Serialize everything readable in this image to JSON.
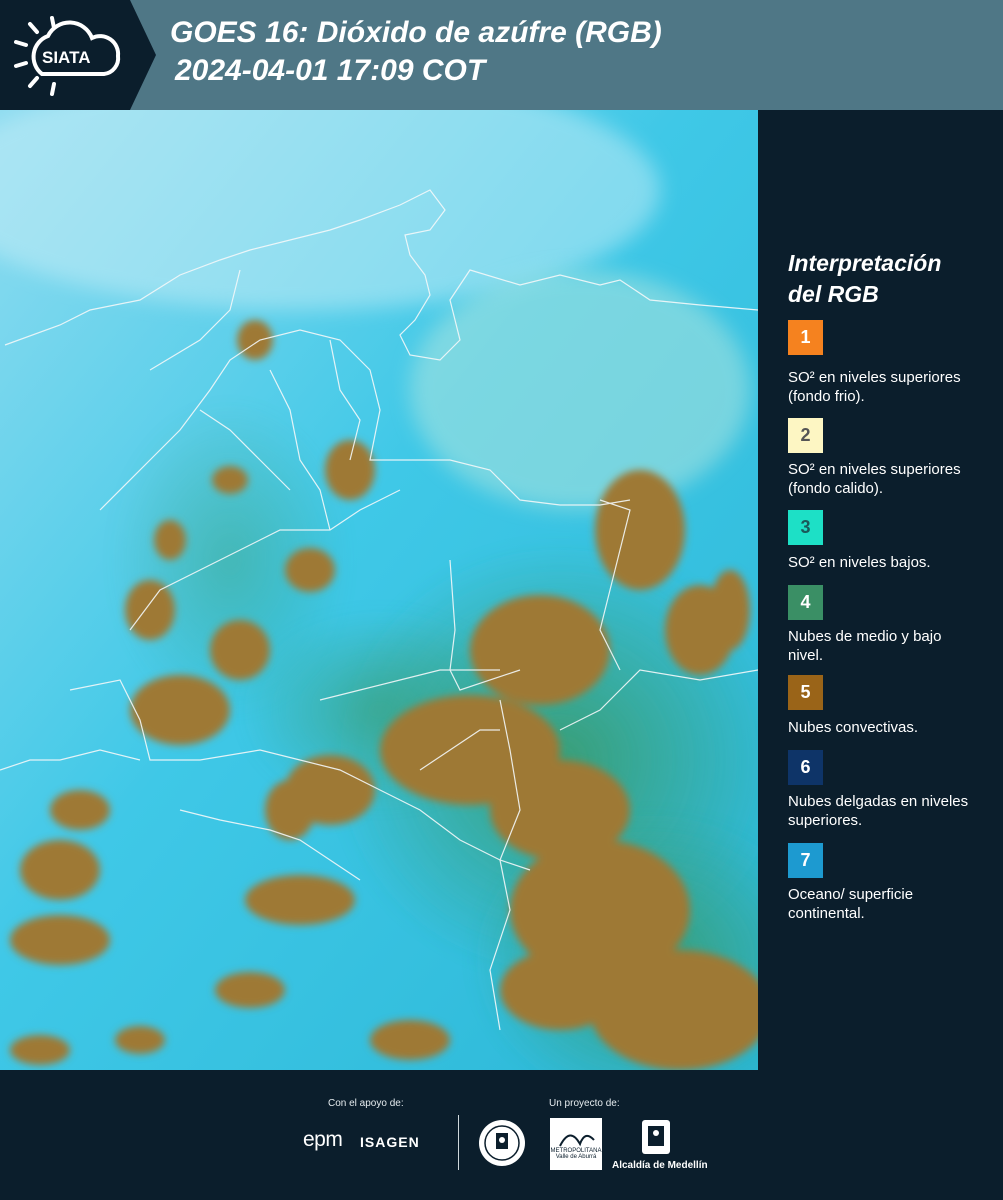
{
  "header": {
    "logo_text": "SIATA",
    "title_line1": "GOES 16: Dióxido de azúfre (RGB)",
    "title_line2": "2024-04-01 17:09 COT"
  },
  "legend": {
    "title_line1": "Interpretación",
    "title_line2": "del RGB",
    "items": [
      {
        "number": "1",
        "label": "SO² en niveles superiores (fondo frio).",
        "color": "#f5821f",
        "text_color": "#ffffff"
      },
      {
        "number": "2",
        "label": "SO² en niveles superiores (fondo calido).",
        "color": "#fdf6c3",
        "text_color": "#555555"
      },
      {
        "number": "3",
        "label": "SO² en niveles bajos.",
        "color": "#1de0c6",
        "text_color": "#1a5a5a"
      },
      {
        "number": "4",
        "label": "Nubes de medio y bajo nivel.",
        "color": "#3a8f65",
        "text_color": "#ffffff"
      },
      {
        "number": "5",
        "label": "Nubes convectivas.",
        "color": "#9a6418",
        "text_color": "#ffffff"
      },
      {
        "number": "6",
        "label": "Nubes delgadas en niveles superiores.",
        "color": "#0e3468",
        "text_color": "#ffffff"
      },
      {
        "number": "7",
        "label": "Oceano/ superficie continental.",
        "color": "#1d9ad0",
        "text_color": "#ffffff"
      }
    ]
  },
  "footer": {
    "support_caption": "Con el apoyo de:",
    "project_caption": "Un proyecto de:",
    "epm": "epm",
    "isagen": "ISAGEN",
    "area_text": "METROPOLITANA Valle de Aburrá",
    "alcaldia": "Alcaldía de Medellín"
  },
  "colors": {
    "background": "#0b1e2c",
    "header_bar": "#4f7786",
    "ocean": "#3ec6e6",
    "convective": "#9a7a34",
    "midlevel": "#3a8f65"
  }
}
